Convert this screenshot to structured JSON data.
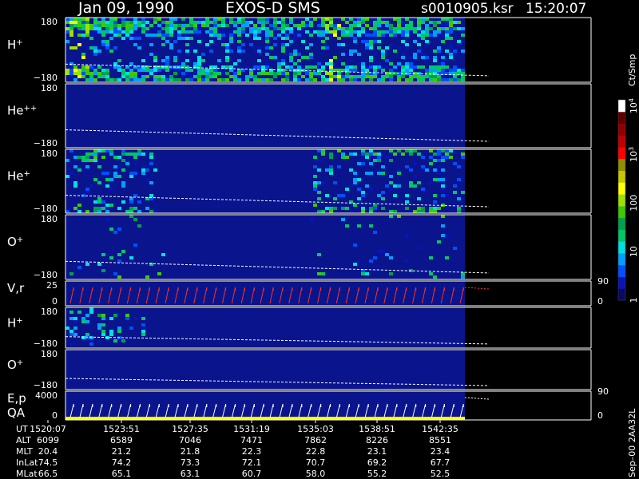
{
  "header": {
    "date": "Jan 09, 1990",
    "mission": "EXOS-D SMS",
    "file": "s0010905.ksr",
    "time": "15:20:07"
  },
  "colorbar": {
    "unit_label": "Ct/Smp",
    "tick_labels": [
      "1",
      "10",
      "100",
      "10",
      "10"
    ],
    "tick_superscripts": [
      "",
      "",
      "",
      "3",
      "4"
    ],
    "log_range": [
      0,
      4
    ],
    "colors": [
      "#0a0a64",
      "#0a14b4",
      "#0050ff",
      "#00a0ff",
      "#00e0e0",
      "#00c864",
      "#00a050",
      "#40c800",
      "#a0e000",
      "#ffff00",
      "#c8c800",
      "#909000",
      "#ff0000",
      "#c00000",
      "#900000",
      "#600000",
      "#ffffff"
    ]
  },
  "chart_data": [
    {
      "type": "heatmap",
      "panel": "h-plus-high",
      "label": "H",
      "label_sup": "+",
      "ylim": [
        -180,
        180
      ],
      "yticks": [
        "180",
        "−180"
      ],
      "density": 0.75,
      "band_top": 0.45,
      "band_bottom": 0.45,
      "bright_columns_fraction": [
        0.0,
        0.05,
        0.65,
        0.68
      ],
      "valid_until_fraction": 1.0
    },
    {
      "type": "heatmap",
      "panel": "he-plus-plus",
      "label": "He",
      "label_sup": "++",
      "ylim": [
        -180,
        180
      ],
      "yticks": [
        "180",
        "−180"
      ],
      "density": 0.0,
      "valid_until_fraction": 1.0
    },
    {
      "type": "heatmap",
      "panel": "he-plus",
      "label": "He",
      "label_sup": "+",
      "ylim": [
        -180,
        180
      ],
      "yticks": [
        "180",
        "−180"
      ],
      "density": 0.45,
      "band_top": 0.25,
      "band_bottom": 0.25,
      "active_spans_fraction": [
        [
          0.0,
          0.22
        ],
        [
          0.62,
          1.0
        ]
      ],
      "valid_until_fraction": 1.0
    },
    {
      "type": "heatmap",
      "panel": "o-plus",
      "label": "O",
      "label_sup": "+",
      "ylim": [
        -180,
        180
      ],
      "yticks": [
        "180",
        "−180"
      ],
      "density": 0.12,
      "band_top": 0.0,
      "band_bottom": 0.25,
      "active_spans_fraction": [
        [
          0.0,
          0.25
        ],
        [
          0.6,
          1.0
        ]
      ],
      "valid_until_fraction": 1.0
    },
    {
      "type": "line",
      "panel": "v-r",
      "label": "V,r",
      "ylim": [
        0,
        25
      ],
      "yticks": [
        "25",
        "0"
      ],
      "right_ticks": [
        "90",
        "0"
      ],
      "sawtooth_periods": 42,
      "valid_until_fraction": 1.0
    },
    {
      "type": "heatmap",
      "panel": "h-plus-low",
      "label": "H",
      "label_sup": "+",
      "ylim": [
        -180,
        180
      ],
      "yticks": [
        "180",
        "−180"
      ],
      "density": 0.6,
      "active_spans_fraction": [
        [
          0.0,
          0.2
        ]
      ],
      "valid_until_fraction": 1.0
    },
    {
      "type": "heatmap",
      "panel": "o-plus-low",
      "label": "O",
      "label_sup": "+",
      "ylim": [
        -180,
        180
      ],
      "yticks": [
        "180",
        "−180"
      ],
      "density": 0.0,
      "valid_until_fraction": 1.0
    },
    {
      "type": "line",
      "panel": "e-p-qa",
      "label": "E,p",
      "label2": "QA",
      "ylim": [
        0,
        4000
      ],
      "yticks": [
        "4000",
        "0"
      ],
      "right_ticks": [
        "90",
        "0"
      ],
      "sawtooth_periods": 42,
      "valid_until_fraction": 1.0
    }
  ],
  "time_axis": {
    "rows": [
      {
        "label": "UT",
        "values": [
          "1520:07",
          "1523:51",
          "1527:35",
          "1531:19",
          "1535:03",
          "1538:51",
          "1542:35"
        ]
      },
      {
        "label": "ALT",
        "values": [
          "6099",
          "6589",
          "7046",
          "7471",
          "7862",
          "8226",
          "8551"
        ]
      },
      {
        "label": "MLT",
        "values": [
          "20.4",
          "21.2",
          "21.8",
          "22.3",
          "22.8",
          "23.1",
          "23.4"
        ]
      },
      {
        "label": "InLat",
        "values": [
          "74.5",
          "74.2",
          "73.3",
          "72.1",
          "70.7",
          "69.2",
          "67.7"
        ]
      },
      {
        "label": "MLat",
        "values": [
          "66.5",
          "65.1",
          "63.1",
          "60.7",
          "58.0",
          "55.2",
          "52.5"
        ]
      }
    ]
  },
  "footer_note": "Sep–00  2AA32L"
}
